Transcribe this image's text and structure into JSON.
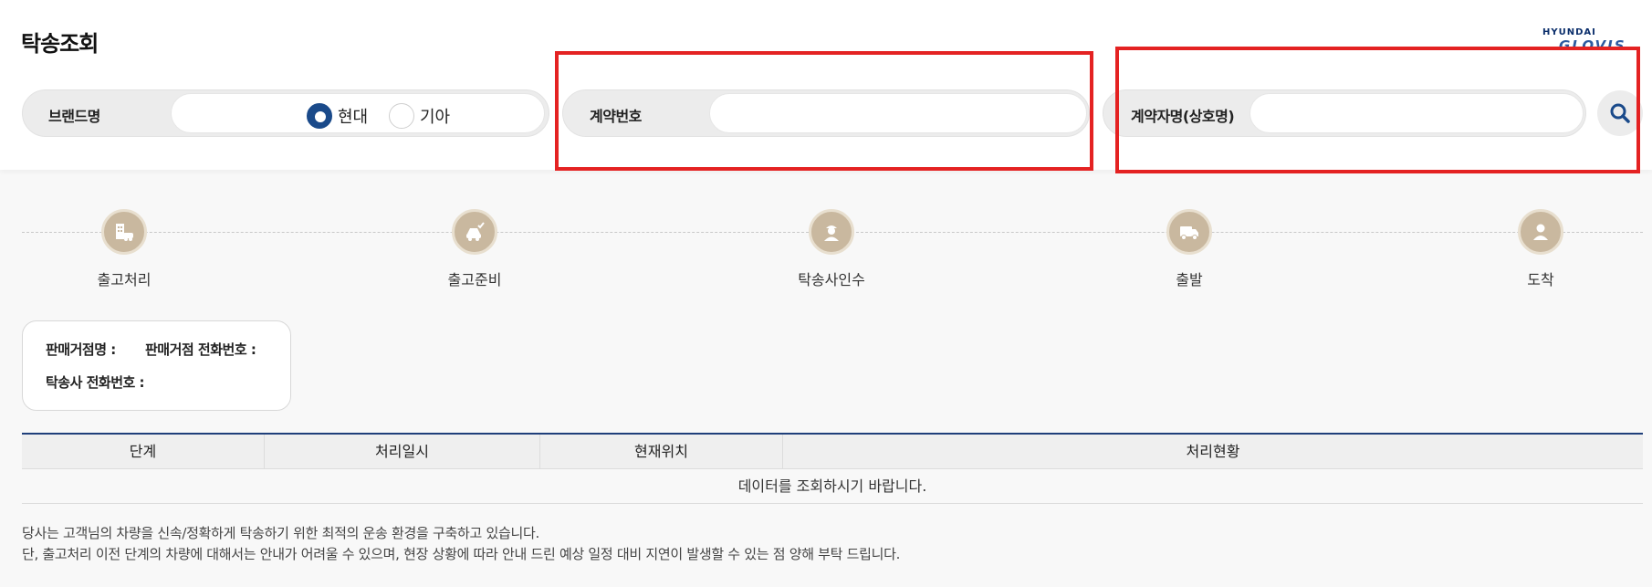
{
  "page": {
    "title": "탁송조회",
    "logo_top": "HYUNDAI",
    "logo_bottom": "GLOVIS"
  },
  "search": {
    "brand_label": "브랜드명",
    "brand_options": [
      {
        "label": "현대",
        "selected": true
      },
      {
        "label": "기아",
        "selected": false
      }
    ],
    "contract_no_label": "계약번호",
    "contract_no_value": "",
    "contractor_label": "계약자명(상호명)",
    "contractor_value": "",
    "search_icon": "search-icon"
  },
  "steps": [
    {
      "label": "출고처리",
      "icon": "building-car-icon"
    },
    {
      "label": "출고준비",
      "icon": "car-check-icon"
    },
    {
      "label": "탁송사인수",
      "icon": "driver-icon"
    },
    {
      "label": "출발",
      "icon": "truck-icon"
    },
    {
      "label": "도착",
      "icon": "person-icon"
    }
  ],
  "info": {
    "dealer_name_label": "판매거점명 :",
    "dealer_phone_label": "판매거점 전화번호 :",
    "carrier_phone_label": "탁송사 전화번호 :"
  },
  "table": {
    "columns": [
      "단계",
      "처리일시",
      "현재위치",
      "처리현황"
    ],
    "empty_message": "데이터를 조회하시기 바랍니다."
  },
  "notice": {
    "line1": "당사는 고객님의 차량을 신속/정확하게 탁송하기 위한 최적의 운송 환경을 구축하고 있습니다.",
    "line2": "단, 출고처리 이전 단계의 차량에 대해서는 안내가 어려울 수 있으며, 현장 상황에 따라 안내 드린 예상 일정 대비 지연이 발생할 수 있는 점 양해 부탁 드립니다."
  },
  "colors": {
    "accent": "#1a4a8a",
    "highlight": "#e42222",
    "step_icon": "#c9b89f"
  }
}
